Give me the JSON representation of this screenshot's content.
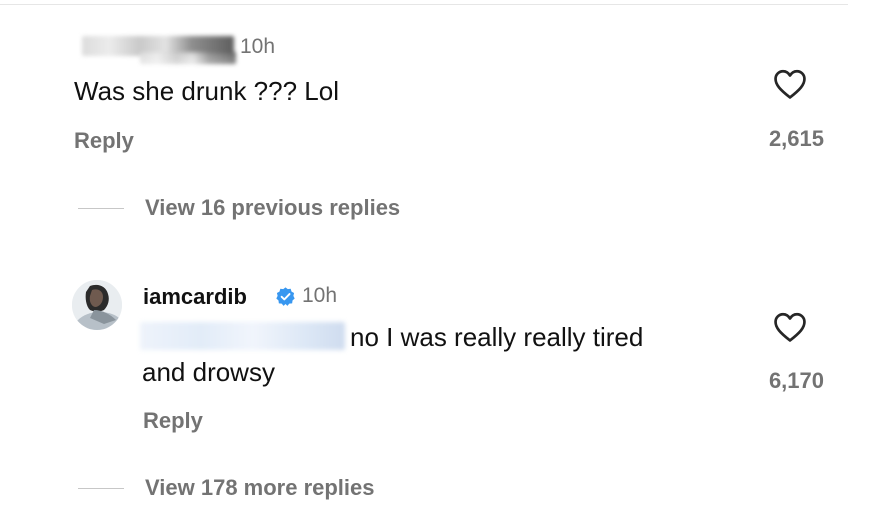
{
  "comment1": {
    "time": "10h",
    "text": "Was she drunk ??? Lol",
    "reply_label": "Reply",
    "like_count": "2,615",
    "view_replies_label": "View 16 previous replies"
  },
  "comment2": {
    "username": "iamcardib",
    "time": "10h",
    "text_line1": "no I was really really tired",
    "text_line2": "and drowsy",
    "reply_label": "Reply",
    "like_count": "6,170",
    "view_replies_label": "View 178 more replies"
  },
  "icons": {
    "like": "heart-outline-icon",
    "verified": "verified-badge-icon"
  },
  "colors": {
    "verified": "#3897f0",
    "secondary_text": "#737373"
  }
}
